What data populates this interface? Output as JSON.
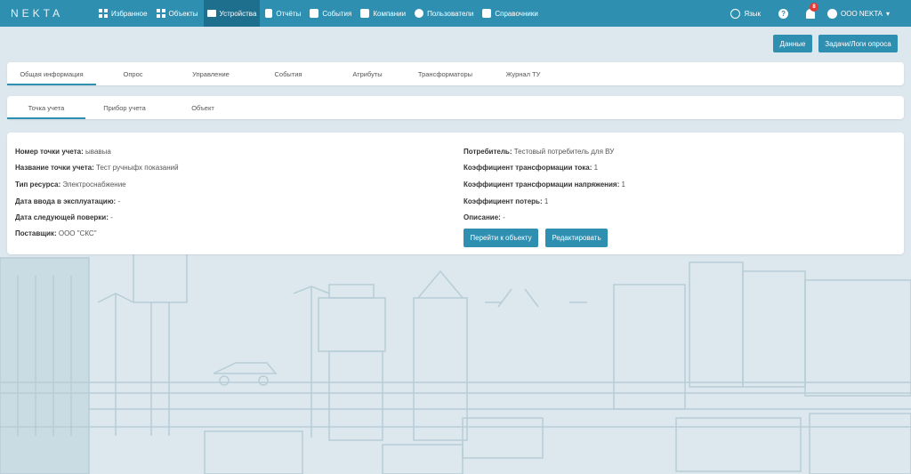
{
  "brand": "NEKTA",
  "nav": [
    {
      "label": "Избранное",
      "icon": "grid-icon"
    },
    {
      "label": "Объекты",
      "icon": "grid-icon"
    },
    {
      "label": "Устройства",
      "icon": "monitor-icon",
      "active": true
    },
    {
      "label": "Отчёты",
      "icon": "document-icon"
    },
    {
      "label": "События",
      "icon": "checkbox-icon"
    },
    {
      "label": "Компании",
      "icon": "building-icon"
    },
    {
      "label": "Пользователи",
      "icon": "user-icon"
    },
    {
      "label": "Справочники",
      "icon": "book-icon"
    }
  ],
  "right_nav": {
    "language": "Язык",
    "help": "?",
    "notifications_count": "8",
    "user": "ООО NEKTA"
  },
  "actions": {
    "data": "Данные",
    "tasks": "Задачи/Логи опроса"
  },
  "tabs_main": [
    "Общая информация",
    "Опрос",
    "Управление",
    "События",
    "Атрибуты",
    "Трансформаторы",
    "Журнал ТУ"
  ],
  "tabs_sub": [
    "Точка учета",
    "Прибор учета",
    "Объект"
  ],
  "info_left": [
    {
      "label": "Номер точки учета:",
      "value": "ывавыа"
    },
    {
      "label": "Название точки учета:",
      "value": "Тест ручныфх показаний"
    },
    {
      "label": "Тип ресурса:",
      "value": "Электроснабжение"
    },
    {
      "label": "Дата ввода в эксплуатацию:",
      "value": "-"
    },
    {
      "label": "Дата следующей поверки:",
      "value": "-"
    },
    {
      "label": "Поставщик:",
      "value": "ООО \"СКС\""
    }
  ],
  "info_right": [
    {
      "label": "Потребитель:",
      "value": "Тестовый потребитель для ВУ"
    },
    {
      "label": "Коэффициент трансформации тока:",
      "value": "1"
    },
    {
      "label": "Коэффициент трансформации напряжения:",
      "value": "1"
    },
    {
      "label": "Коэффициент потерь:",
      "value": "1"
    },
    {
      "label": "Описание:",
      "value": "-"
    }
  ],
  "buttons": {
    "go_to_object": "Перейти к объекту",
    "edit": "Редактировать"
  },
  "colors": {
    "primary": "#2e8fb0",
    "primary_dark": "#1e6e8e",
    "background": "#dce8ee",
    "badge": "#e53935"
  }
}
